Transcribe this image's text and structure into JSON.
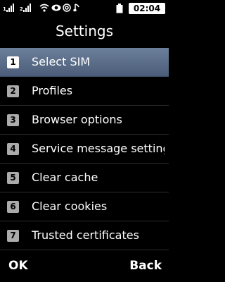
{
  "statusbar": {
    "sim1_label": "1",
    "sim2_label": "2",
    "clock": "02:04",
    "icons": [
      "signal-sim1-icon",
      "signal-sim2-icon",
      "wifi-icon",
      "eye-icon",
      "at-icon",
      "music-note-icon",
      "battery-icon"
    ]
  },
  "title": "Settings",
  "menu": {
    "items": [
      {
        "num": "1",
        "label": "Select SIM"
      },
      {
        "num": "2",
        "label": "Profiles"
      },
      {
        "num": "3",
        "label": "Browser options"
      },
      {
        "num": "4",
        "label": "Service message settings"
      },
      {
        "num": "5",
        "label": "Clear cache"
      },
      {
        "num": "6",
        "label": "Clear cookies"
      },
      {
        "num": "7",
        "label": "Trusted certificates"
      }
    ],
    "selected_index": 0
  },
  "softkeys": {
    "left": "OK",
    "right": "Back"
  },
  "colors": {
    "background": "#000000",
    "highlight": "#5b6e8a",
    "badge": "#ababab"
  }
}
